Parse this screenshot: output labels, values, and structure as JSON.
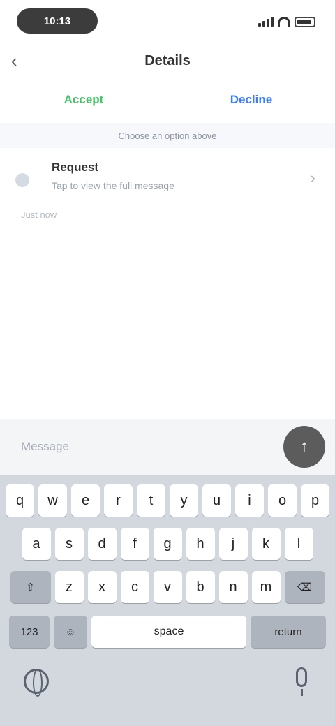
{
  "status_bar": {
    "time": "10:13",
    "icons": [
      "signal-icon",
      "wifi-icon",
      "battery-icon"
    ]
  },
  "header": {
    "back_icon": "chevron-left-icon",
    "title": "Details"
  },
  "tabs": [
    {
      "label": "Accept",
      "color": "#4cbf6a"
    },
    {
      "label": "Decline",
      "color": "#3d7df2"
    }
  ],
  "notice": "Choose an option above",
  "list_item": {
    "title": "Request",
    "subtitle": "Tap to view the full message",
    "meta": "Just now",
    "chevron_icon": "chevron-right-icon"
  },
  "compose": {
    "placeholder": "Message",
    "send_icon": "arrow-up-icon"
  },
  "keyboard": {
    "row1": [
      "q",
      "w",
      "e",
      "r",
      "t",
      "y",
      "u",
      "i",
      "o",
      "p"
    ],
    "row2": [
      "a",
      "s",
      "d",
      "f",
      "g",
      "h",
      "j",
      "k",
      "l"
    ],
    "row3": [
      "z",
      "x",
      "c",
      "v",
      "b",
      "n",
      "m"
    ],
    "shift_label": "⇧",
    "delete_label": "⌫",
    "numbers_label": "123",
    "emoji_label": "☺",
    "space_label": "space",
    "return_label": "return",
    "globe_icon": "globe-icon",
    "mic_icon": "microphone-icon"
  }
}
